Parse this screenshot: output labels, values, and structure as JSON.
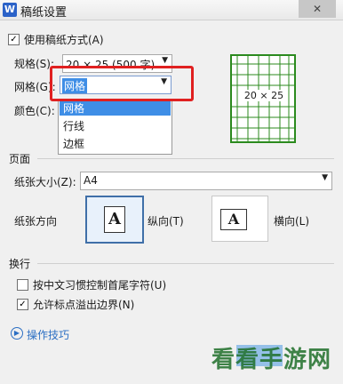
{
  "window": {
    "title": "稿纸设置",
    "app_icon": "W",
    "close_glyph": "✕"
  },
  "use_draft": {
    "label": "使用稿纸方式(A)",
    "checked": true
  },
  "spec": {
    "label": "规格(S):",
    "value": "20 × 25 (500 字)"
  },
  "grid": {
    "label": "网格(G):",
    "value": "网格",
    "options": [
      "网格",
      "行线",
      "边框"
    ]
  },
  "color": {
    "label": "颜色(C):"
  },
  "preview": {
    "text": "20 × 25",
    "accent": "#2b8a1e"
  },
  "page": {
    "section_label": "页面",
    "paper_size_label": "纸张大小(Z):",
    "paper_size_value": "A4",
    "orientation_label": "纸张方向",
    "portrait_label": "纵向(T)",
    "landscape_label": "横向(L)",
    "page_icon_letter": "A"
  },
  "wrap": {
    "section_label": "换行",
    "option1": {
      "label": "按中文习惯控制首尾字符(U)",
      "checked": false
    },
    "option2": {
      "label": "允许标点溢出边界(N)",
      "checked": true
    }
  },
  "tips": {
    "label": "操作技巧"
  },
  "watermark": {
    "text": "看看手游网"
  }
}
